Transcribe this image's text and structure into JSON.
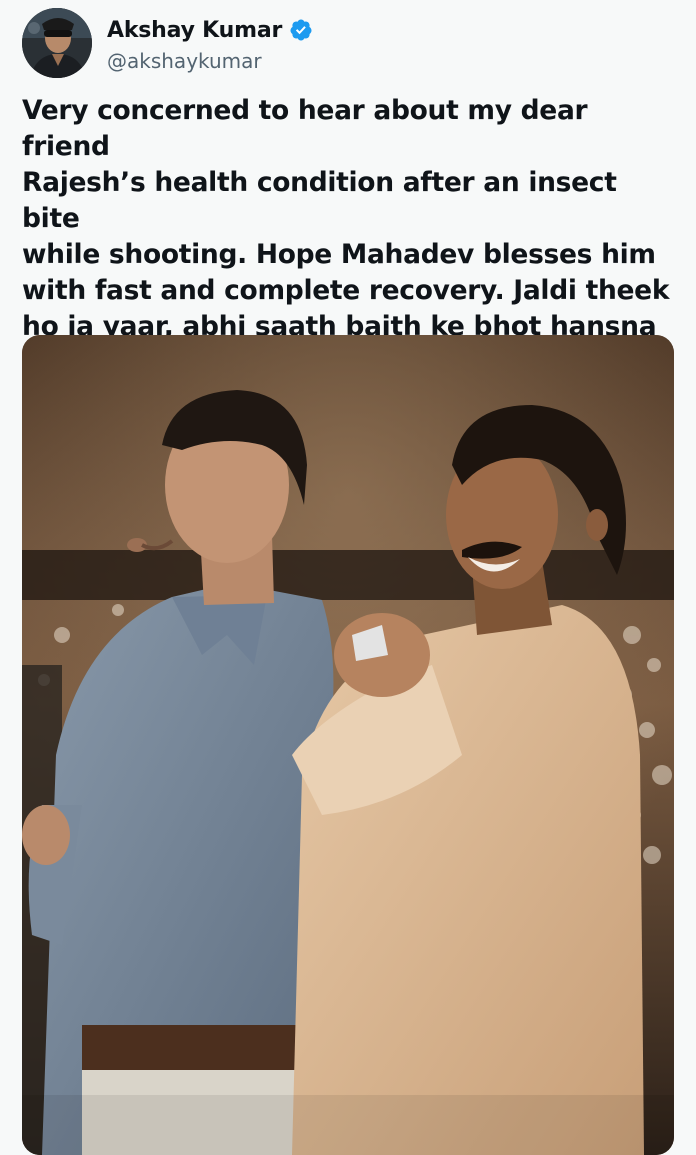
{
  "author": {
    "display_name": "Akshay Kumar",
    "handle": "@akshaykumar",
    "verified": true,
    "verified_color": "#1d9bf0",
    "avatar_icon": "profile-photo"
  },
  "tweet": {
    "text": "Very concerned to hear about my dear friend\nRajesh’s health condition after an insect bite\nwhile shooting. Hope Mahadev blesses him\nwith fast and complete recovery. Jaldi theek\nho ja yaar, abhi saath baith ke bhot hansna\nhai."
  },
  "media": {
    "type": "photo",
    "description_icon": "photo-two-men-laughing"
  },
  "colors": {
    "background": "#f7f9f9",
    "text": "#0f1419",
    "secondary_text": "#536471"
  }
}
